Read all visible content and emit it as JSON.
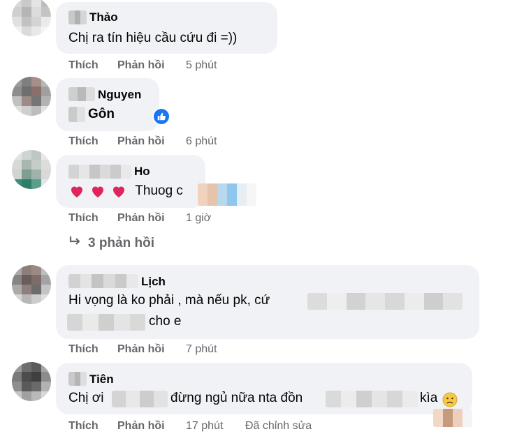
{
  "comments": [
    {
      "author": "Thảo",
      "text": "Chị ra tín hiệu cầu cứu đi =))",
      "actions": {
        "like": "Thích",
        "reply": "Phản hồi",
        "time": "5 phút"
      }
    },
    {
      "author_line1": "Nguyen",
      "author_line2": "Gôn",
      "reaction_icon": "thumbs-up-icon",
      "actions": {
        "like": "Thích",
        "reply": "Phản hồi",
        "time": "6 phút"
      }
    },
    {
      "author": "Ho",
      "text": "Thuog c",
      "emoji": [
        "heart",
        "heart",
        "heart"
      ],
      "actions": {
        "like": "Thích",
        "reply": "Phản hồi",
        "time": "1 giờ"
      },
      "replies_label": "3 phản hồi"
    },
    {
      "author": "Lịch",
      "text_line1": "Hi vọng là ko phải , mà nếu pk, cứ",
      "text_line2": "cho e",
      "actions": {
        "like": "Thích",
        "reply": "Phản hồi",
        "time": "7 phút"
      }
    },
    {
      "author": "Tiên",
      "text_part1": "Chị ơi",
      "text_part2": "đừng ngủ nữa nta đồn",
      "text_part3": "kìa",
      "emoji": "worried-face",
      "actions": {
        "like": "Thích",
        "reply": "Phản hồi",
        "time": "17 phút",
        "edited": "Đã chỉnh sửa"
      }
    }
  ],
  "colors": {
    "bubble": "#f0f2f5",
    "meta_text": "#65676b",
    "like_blue": "#1877f2",
    "heart_red": "#e0245e"
  }
}
